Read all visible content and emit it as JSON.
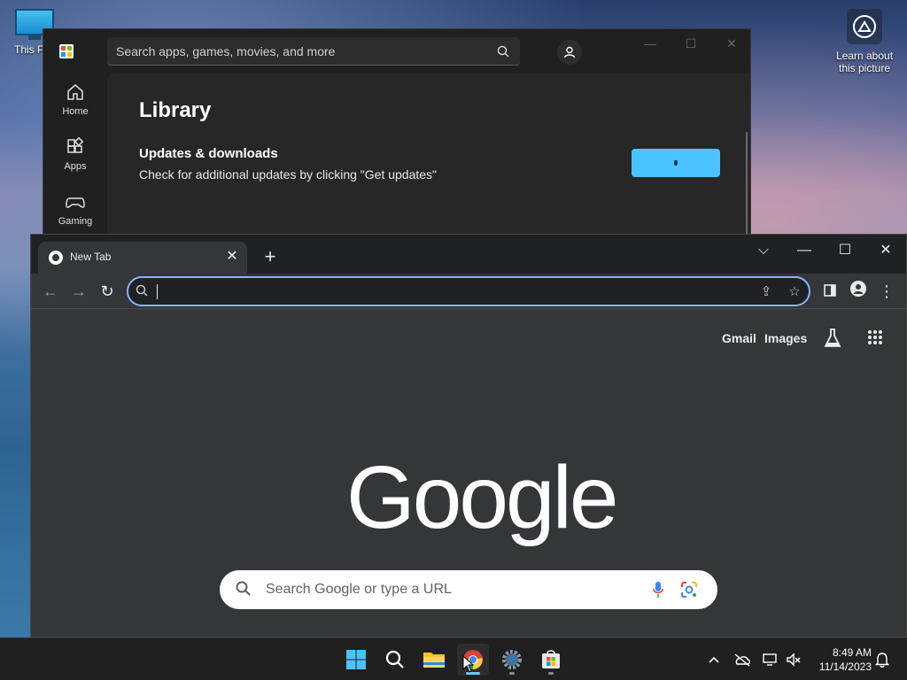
{
  "desktop": {
    "this_pc_label": "This PC",
    "learn_label": "Learn about this picture"
  },
  "store": {
    "search_placeholder": "Search apps, games, movies, and more",
    "nav": [
      {
        "label": "Home",
        "icon": "home-icon"
      },
      {
        "label": "Apps",
        "icon": "apps-icon"
      },
      {
        "label": "Gaming",
        "icon": "gaming-icon"
      }
    ],
    "title": "Library",
    "updates_title": "Updates & downloads",
    "updates_subtitle": "Check for additional updates by clicking \"Get updates\"",
    "accent_color": "#4cc2ff"
  },
  "chrome": {
    "tab_title": "New Tab",
    "omnibox_value": "",
    "ntp": {
      "gmail": "Gmail",
      "images": "Images",
      "logo": "Google",
      "search_placeholder": "Search Google or type a URL"
    },
    "focus_color": "#8ab4f8"
  },
  "taskbar": {
    "apps": [
      "start-icon",
      "search-icon",
      "file-explorer-icon",
      "chrome-icon",
      "settings-icon",
      "store-icon"
    ],
    "time": "8:49 AM",
    "date": "11/14/2023"
  }
}
